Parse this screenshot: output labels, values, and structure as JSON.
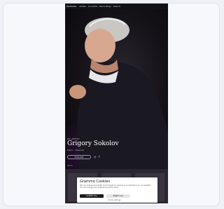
{
  "site": {
    "logo": "Deutsche",
    "nav": [
      "Artists",
      "Concerts",
      "Recordings",
      "Search"
    ]
  },
  "hero": {
    "kicker": "DG ARTIST",
    "artist_name": "Grigory Sokolov",
    "subline": "Piano · Classical",
    "follow_label": "FOLLOW",
    "social_icons": [
      "instagram-icon",
      "facebook-icon"
    ],
    "more_link": "More"
  },
  "cookie_banner": {
    "title": "Grammo Cookies",
    "text": "We use cookies and similar technologies to improve your experience on our website. You can change your preferences at any time.",
    "accept_label": "ACCEPT ALL",
    "reject_label": "REJECT ALL",
    "settings_link": "Cookie settings"
  },
  "colors": {
    "background": "#0b0a0f",
    "accent": "#8a2b8a"
  }
}
